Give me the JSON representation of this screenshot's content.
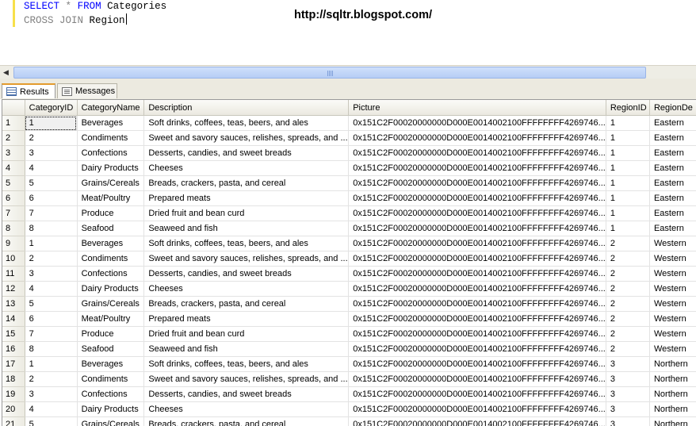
{
  "editor": {
    "line1": {
      "kw1": "SELECT",
      "op": "*",
      "kw2": "FROM",
      "table": "Categories"
    },
    "line2": {
      "kw": "CROSS JOIN",
      "table": "Region"
    }
  },
  "watermark": "http://sqltr.blogspot.com/",
  "tabs": {
    "results": "Results",
    "messages": "Messages"
  },
  "grid": {
    "columns": [
      "CategoryID",
      "CategoryName",
      "Description",
      "Picture",
      "RegionID",
      "RegionDe"
    ],
    "rows": [
      [
        "1",
        "1",
        "Beverages",
        "Soft drinks, coffees, teas, beers, and ales",
        "0x151C2F00020000000D000E0014002100FFFFFFFF4269746...",
        "1",
        "Eastern"
      ],
      [
        "2",
        "2",
        "Condiments",
        "Sweet and savory sauces, relishes, spreads, and ...",
        "0x151C2F00020000000D000E0014002100FFFFFFFF4269746...",
        "1",
        "Eastern"
      ],
      [
        "3",
        "3",
        "Confections",
        "Desserts, candies, and sweet breads",
        "0x151C2F00020000000D000E0014002100FFFFFFFF4269746...",
        "1",
        "Eastern"
      ],
      [
        "4",
        "4",
        "Dairy Products",
        "Cheeses",
        "0x151C2F00020000000D000E0014002100FFFFFFFF4269746...",
        "1",
        "Eastern"
      ],
      [
        "5",
        "5",
        "Grains/Cereals",
        "Breads, crackers, pasta, and cereal",
        "0x151C2F00020000000D000E0014002100FFFFFFFF4269746...",
        "1",
        "Eastern"
      ],
      [
        "6",
        "6",
        "Meat/Poultry",
        "Prepared meats",
        "0x151C2F00020000000D000E0014002100FFFFFFFF4269746...",
        "1",
        "Eastern"
      ],
      [
        "7",
        "7",
        "Produce",
        "Dried fruit and bean curd",
        "0x151C2F00020000000D000E0014002100FFFFFFFF4269746...",
        "1",
        "Eastern"
      ],
      [
        "8",
        "8",
        "Seafood",
        "Seaweed and fish",
        "0x151C2F00020000000D000E0014002100FFFFFFFF4269746...",
        "1",
        "Eastern"
      ],
      [
        "9",
        "1",
        "Beverages",
        "Soft drinks, coffees, teas, beers, and ales",
        "0x151C2F00020000000D000E0014002100FFFFFFFF4269746...",
        "2",
        "Western"
      ],
      [
        "10",
        "2",
        "Condiments",
        "Sweet and savory sauces, relishes, spreads, and ...",
        "0x151C2F00020000000D000E0014002100FFFFFFFF4269746...",
        "2",
        "Western"
      ],
      [
        "11",
        "3",
        "Confections",
        "Desserts, candies, and sweet breads",
        "0x151C2F00020000000D000E0014002100FFFFFFFF4269746...",
        "2",
        "Western"
      ],
      [
        "12",
        "4",
        "Dairy Products",
        "Cheeses",
        "0x151C2F00020000000D000E0014002100FFFFFFFF4269746...",
        "2",
        "Western"
      ],
      [
        "13",
        "5",
        "Grains/Cereals",
        "Breads, crackers, pasta, and cereal",
        "0x151C2F00020000000D000E0014002100FFFFFFFF4269746...",
        "2",
        "Western"
      ],
      [
        "14",
        "6",
        "Meat/Poultry",
        "Prepared meats",
        "0x151C2F00020000000D000E0014002100FFFFFFFF4269746...",
        "2",
        "Western"
      ],
      [
        "15",
        "7",
        "Produce",
        "Dried fruit and bean curd",
        "0x151C2F00020000000D000E0014002100FFFFFFFF4269746...",
        "2",
        "Western"
      ],
      [
        "16",
        "8",
        "Seafood",
        "Seaweed and fish",
        "0x151C2F00020000000D000E0014002100FFFFFFFF4269746...",
        "2",
        "Western"
      ],
      [
        "17",
        "1",
        "Beverages",
        "Soft drinks, coffees, teas, beers, and ales",
        "0x151C2F00020000000D000E0014002100FFFFFFFF4269746...",
        "3",
        "Northern"
      ],
      [
        "18",
        "2",
        "Condiments",
        "Sweet and savory sauces, relishes, spreads, and ...",
        "0x151C2F00020000000D000E0014002100FFFFFFFF4269746...",
        "3",
        "Northern"
      ],
      [
        "19",
        "3",
        "Confections",
        "Desserts, candies, and sweet breads",
        "0x151C2F00020000000D000E0014002100FFFFFFFF4269746...",
        "3",
        "Northern"
      ],
      [
        "20",
        "4",
        "Dairy Products",
        "Cheeses",
        "0x151C2F00020000000D000E0014002100FFFFFFFF4269746...",
        "3",
        "Northern"
      ],
      [
        "21",
        "5",
        "Grains/Cereals",
        "Breads, crackers, pasta, and cereal",
        "0x151C2F00020000000D000E0014002100FFFFFFFF4269746...",
        "3",
        "Northern"
      ]
    ]
  },
  "colors": {
    "keyword": "#0000ff",
    "comment_gray": "#808080",
    "tab_accent": "#e39b2e",
    "scroll_thumb": "#b6cdf5"
  },
  "icons": {
    "results_tab": "grid-icon",
    "messages_tab": "message-icon",
    "scroll_left": "arrow-left-icon"
  }
}
